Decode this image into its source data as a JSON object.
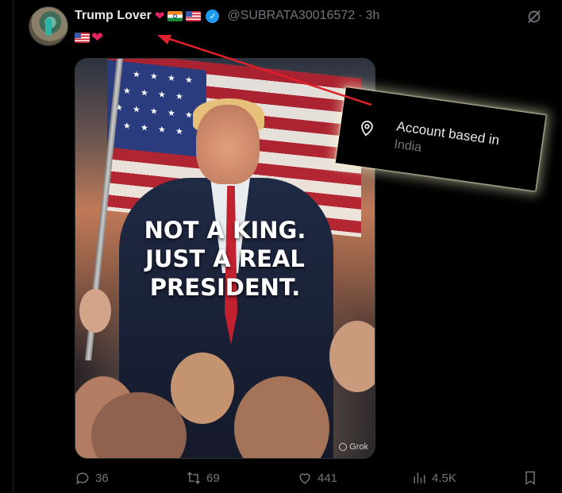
{
  "tweet": {
    "display_name": "Trump Lover",
    "handle": "@SUBRATA30016572",
    "separator": "·",
    "time": "3h",
    "name_emoji": [
      "red-heart",
      "india-flag",
      "us-flag"
    ],
    "bio_emoji": [
      "us-flag",
      "red-heart"
    ]
  },
  "media": {
    "caption_lines": [
      "NOT A KING.",
      "JUST A REAL",
      "PRESIDENT."
    ],
    "watermark": "Grok"
  },
  "overlay": {
    "title": "Account based in",
    "value": "India",
    "icon": "location-pin-icon"
  },
  "actions": {
    "replies": "36",
    "reposts": "69",
    "likes": "441",
    "views": "4.5K"
  },
  "colors": {
    "background": "#000000",
    "text": "#e7e9ea",
    "muted": "#71767b",
    "verified": "#1d9bf0",
    "annotation_arrow": "#e0202a",
    "heart": "#e0245e"
  }
}
